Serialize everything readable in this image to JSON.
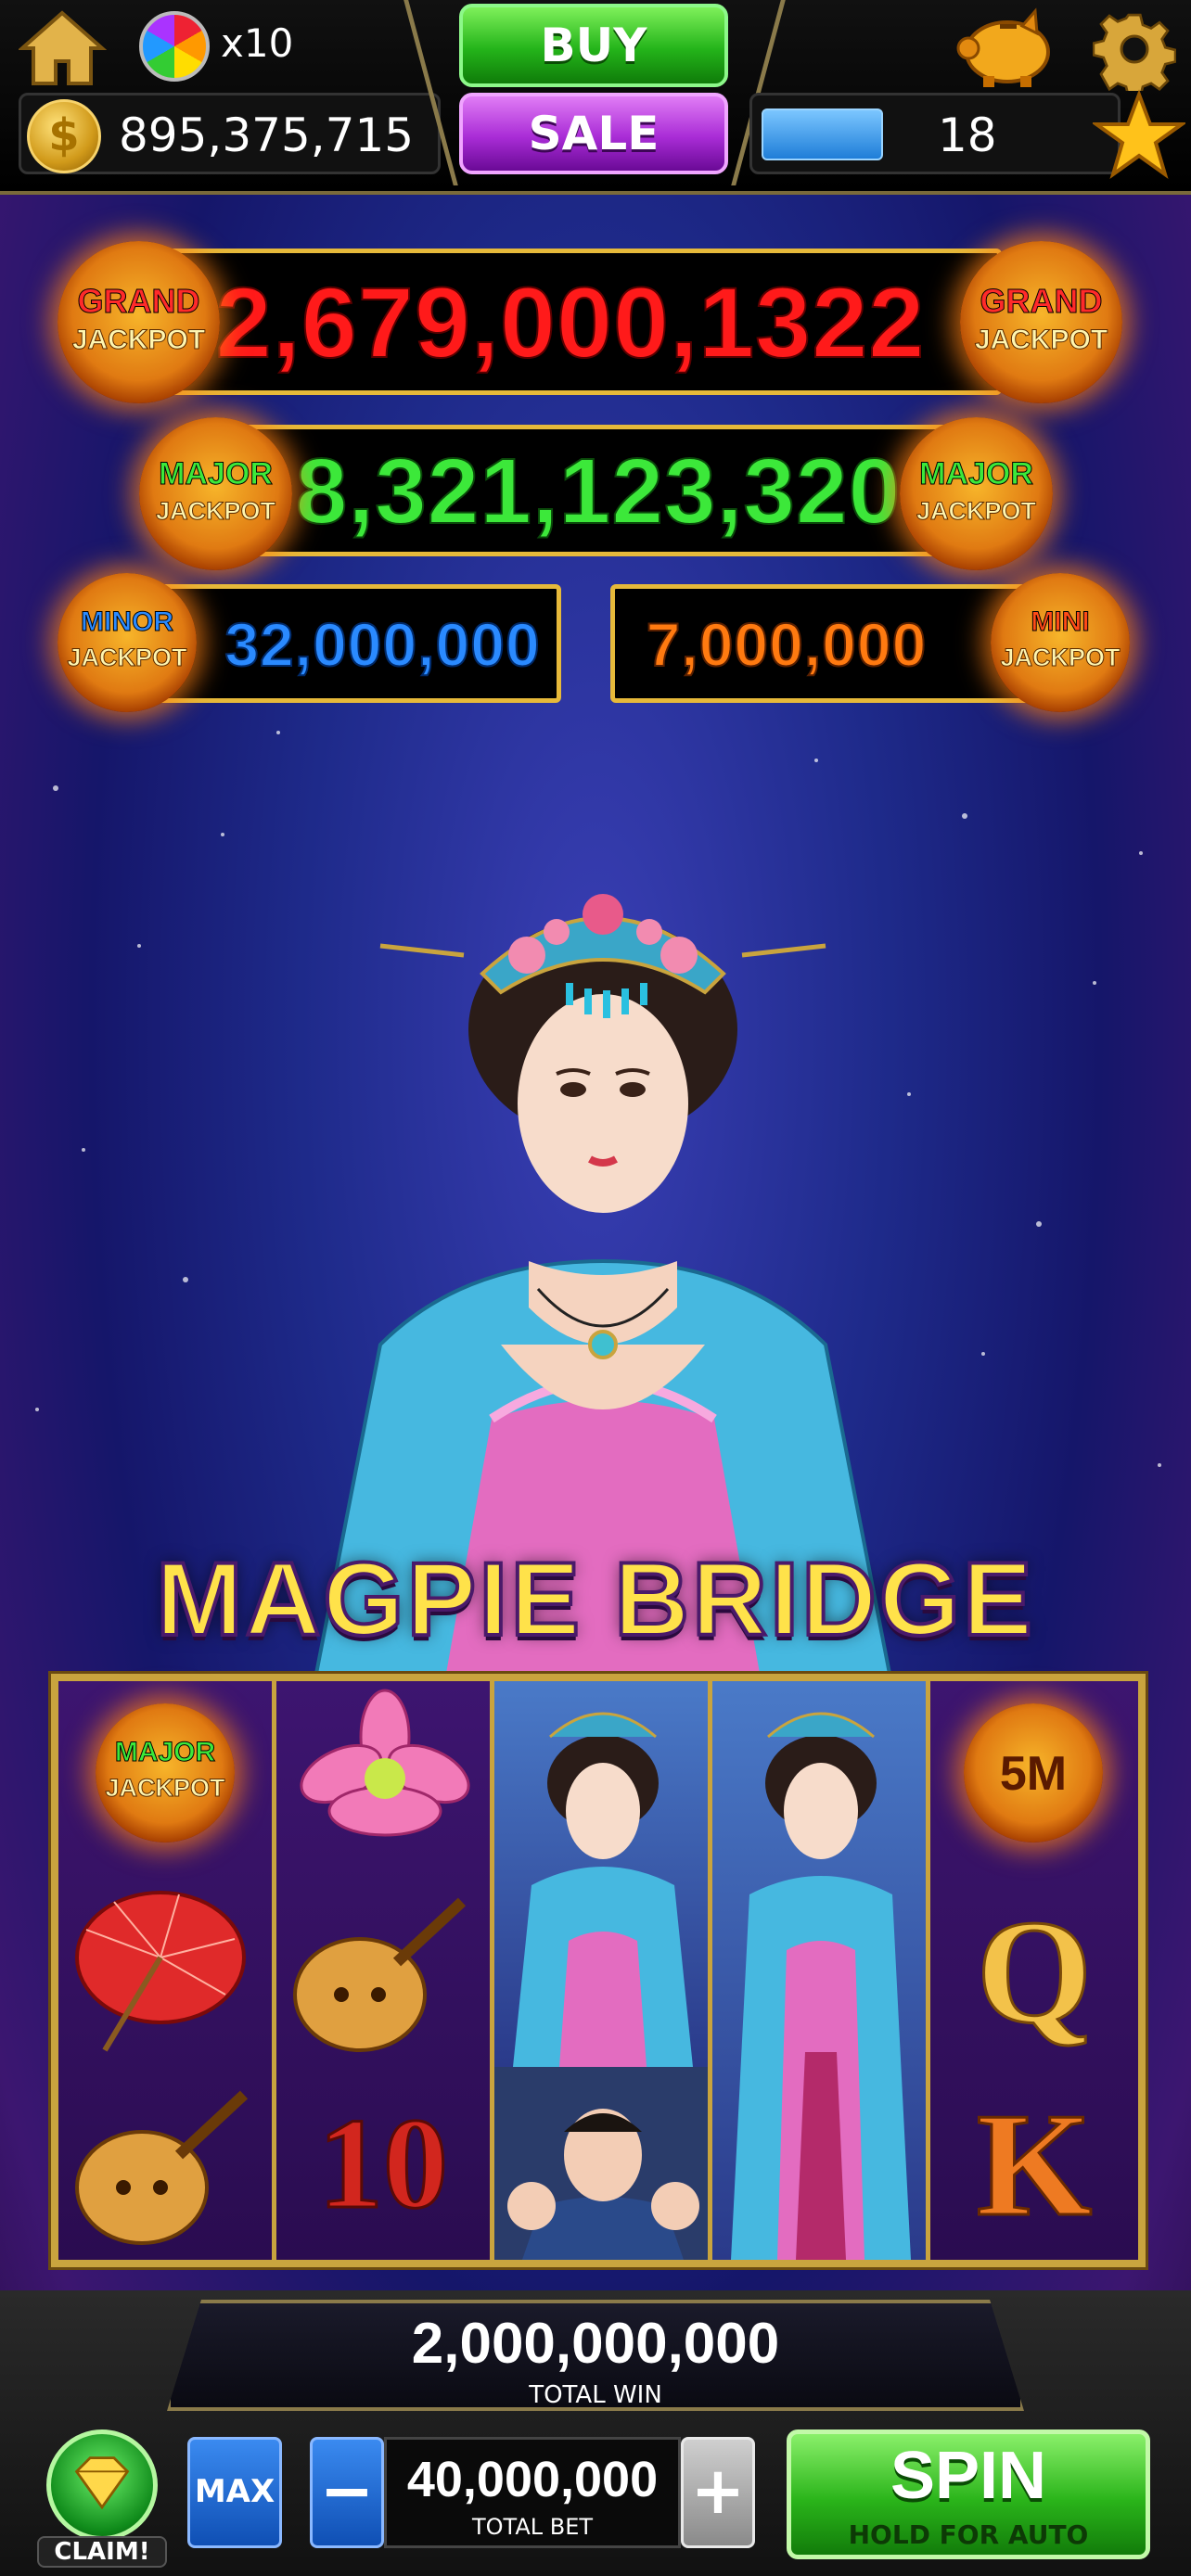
{
  "header": {
    "wheel_count": "x10",
    "coins": "895,375,715",
    "buy_label": "BUY",
    "sale_label": "SALE",
    "level": "18",
    "xp_progress": 0.35
  },
  "jackpots": {
    "grand": {
      "value": "2,679,000,1322",
      "coin_line1": "GRAND",
      "coin_line2": "JACKPOT",
      "color": "#ff1a1a"
    },
    "major": {
      "value": "8,321,123,320",
      "coin_line1": "MAJOR",
      "coin_line2": "JACKPOT",
      "color": "#3ce83a"
    },
    "minor": {
      "value": "32,000,000",
      "coin_line1": "MINOR",
      "coin_line2": "JACKPOT",
      "color": "#2a8aff"
    },
    "mini": {
      "value": "7,000,000",
      "coin_line1": "MINI",
      "coin_line2": "JACKPOT",
      "color": "#ff7a10"
    }
  },
  "game_title": "MAGPIE BRIDGE",
  "reels": {
    "reel1": [
      "major-jackpot-coin",
      "red-parasol",
      "pipa-lute"
    ],
    "reel2": [
      "pink-lotus",
      "pipa-lute",
      "ten"
    ],
    "reel3": [
      "princess-wild",
      "princess-wild",
      "scholar-with-children"
    ],
    "reel4": [
      "princess-wild-stacked"
    ],
    "reel5": [
      "5m-coin",
      "queen",
      "king"
    ],
    "reel1_coin_line1": "MAJOR",
    "reel1_coin_line2": "JACKPOT",
    "reel2_ten": "10",
    "reel5_coin": "5M",
    "reel5_q": "Q",
    "reel5_k": "K"
  },
  "bottom": {
    "total_win": "2,000,000,000",
    "total_win_label": "TOTAL WIN",
    "claim_label": "CLAIM!",
    "max_label": "MAX",
    "minus_label": "−",
    "total_bet": "40,000,000",
    "total_bet_label": "TOTAL BET",
    "plus_label": "+",
    "spin_label": "SPIN",
    "spin_sub": "HOLD FOR AUTO"
  },
  "colors": {
    "gold_frame": "#c9a43e",
    "spin_green": "#2ab41a",
    "sale_purple": "#a92cd6"
  }
}
